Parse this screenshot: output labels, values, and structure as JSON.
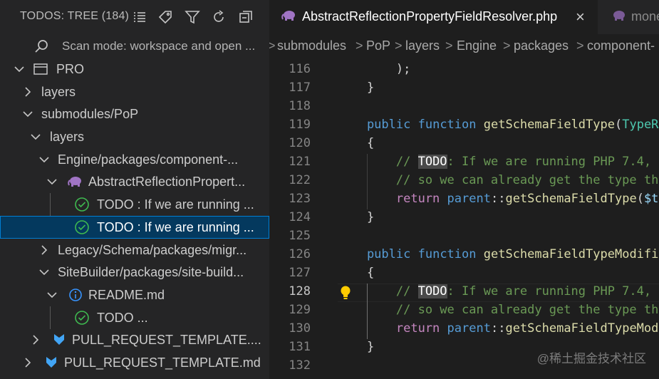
{
  "sidebar": {
    "title": "TODOS: TREE (184)",
    "header_icons": [
      "list-flat-icon",
      "tag-icon",
      "filter-icon",
      "refresh-icon",
      "collapse-all-icon"
    ],
    "scan_mode": "Scan mode: workspace and open ...",
    "tree": [
      {
        "label": "PRO",
        "icon": "folder-window-icon",
        "twistie": "down"
      },
      {
        "label": "layers",
        "icon": "",
        "twistie": "right"
      },
      {
        "label": "submodules/PoP",
        "icon": "",
        "twistie": "down"
      },
      {
        "label": "layers",
        "icon": "",
        "twistie": "down"
      },
      {
        "label": "Engine/packages/component-...",
        "icon": "",
        "twistie": "down"
      },
      {
        "label": "AbstractReflectionPropert...",
        "icon": "php-elephant-icon",
        "twistie": "down"
      },
      {
        "label": "TODO : If we are running ...",
        "icon": "check-circle-icon",
        "twistie": ""
      },
      {
        "label": "TODO : If we are running ...",
        "icon": "check-circle-icon",
        "twistie": ""
      },
      {
        "label": "Legacy/Schema/packages/migr...",
        "icon": "",
        "twistie": "right"
      },
      {
        "label": "SiteBuilder/packages/site-build...",
        "icon": "",
        "twistie": "down"
      },
      {
        "label": "README.md",
        "icon": "info-icon",
        "twistie": "down"
      },
      {
        "label": "TODO ...",
        "icon": "check-circle-icon",
        "twistie": ""
      },
      {
        "label": "PULL_REQUEST_TEMPLATE....",
        "icon": "download-arrow-icon",
        "twistie": "right"
      },
      {
        "label": "PULL_REQUEST_TEMPLATE.md",
        "icon": "download-arrow-icon",
        "twistie": "right"
      }
    ]
  },
  "editor": {
    "tabs": [
      {
        "label": "AbstractReflectionPropertyFieldResolver.php",
        "close": "×",
        "active": true
      },
      {
        "label": "mone",
        "active": false
      }
    ],
    "breadcrumb": [
      "submodules",
      "PoP",
      "layers",
      "Engine",
      "packages",
      "component-"
    ],
    "breadcrumb_sep": ">",
    "lines": [
      {
        "num": "116",
        "tokens": [
          {
            "t": "        );",
            "c": ""
          }
        ]
      },
      {
        "num": "117",
        "tokens": [
          {
            "t": "    }",
            "c": ""
          }
        ]
      },
      {
        "num": "118",
        "tokens": []
      },
      {
        "num": "119",
        "tokens": [
          {
            "t": "    public",
            "c": "kw"
          },
          {
            "t": " ",
            "c": ""
          },
          {
            "t": "function",
            "c": "kw"
          },
          {
            "t": " ",
            "c": ""
          },
          {
            "t": "getSchemaFieldType",
            "c": "fn"
          },
          {
            "t": "(",
            "c": ""
          },
          {
            "t": "TypeR",
            "c": "ty"
          }
        ]
      },
      {
        "num": "120",
        "tokens": [
          {
            "t": "    {",
            "c": ""
          }
        ]
      },
      {
        "num": "121",
        "tokens": [
          {
            "t": "        // ",
            "c": "cm"
          },
          {
            "t": "TODO",
            "c": "todo-hl"
          },
          {
            "t": ": If we are running PHP 7.4,",
            "c": "cm"
          }
        ]
      },
      {
        "num": "122",
        "tokens": [
          {
            "t": "        // so we can already get the type th",
            "c": "cm"
          }
        ]
      },
      {
        "num": "123",
        "tokens": [
          {
            "t": "        return",
            "c": "ctl"
          },
          {
            "t": " ",
            "c": ""
          },
          {
            "t": "parent",
            "c": "kw"
          },
          {
            "t": "::",
            "c": ""
          },
          {
            "t": "getSchemaFieldType",
            "c": "fn"
          },
          {
            "t": "(",
            "c": ""
          },
          {
            "t": "$t",
            "c": "var"
          }
        ]
      },
      {
        "num": "124",
        "tokens": [
          {
            "t": "    }",
            "c": ""
          }
        ]
      },
      {
        "num": "125",
        "tokens": []
      },
      {
        "num": "126",
        "tokens": [
          {
            "t": "    public",
            "c": "kw"
          },
          {
            "t": " ",
            "c": ""
          },
          {
            "t": "function",
            "c": "kw"
          },
          {
            "t": " ",
            "c": ""
          },
          {
            "t": "getSchemaFieldTypeModifi",
            "c": "fn"
          }
        ]
      },
      {
        "num": "127",
        "tokens": [
          {
            "t": "    {",
            "c": ""
          }
        ]
      },
      {
        "num": "128",
        "tokens": [
          {
            "t": "        // ",
            "c": "cm"
          },
          {
            "t": "TODO",
            "c": "todo-hl"
          },
          {
            "t": ": If we are running PHP 7.4,",
            "c": "cm"
          }
        ]
      },
      {
        "num": "129",
        "tokens": [
          {
            "t": "        // so we can already get the type th",
            "c": "cm"
          }
        ]
      },
      {
        "num": "130",
        "tokens": [
          {
            "t": "        return",
            "c": "ctl"
          },
          {
            "t": " ",
            "c": ""
          },
          {
            "t": "parent",
            "c": "kw"
          },
          {
            "t": "::",
            "c": ""
          },
          {
            "t": "getSchemaFieldTypeMod",
            "c": "fn"
          }
        ]
      },
      {
        "num": "131",
        "tokens": [
          {
            "t": "    }",
            "c": ""
          }
        ]
      },
      {
        "num": "132",
        "tokens": []
      }
    ]
  },
  "watermark": "@稀土掘金技术社区",
  "colors": {
    "sidebar_bg": "#252526",
    "editor_bg": "#1e1e1e",
    "selection": "#04395e",
    "focus_border": "#007fd4",
    "check_green": "#3fb950",
    "php_purple": "#a074c4",
    "info_blue": "#3794ff",
    "md_blue": "#42a5f5"
  }
}
